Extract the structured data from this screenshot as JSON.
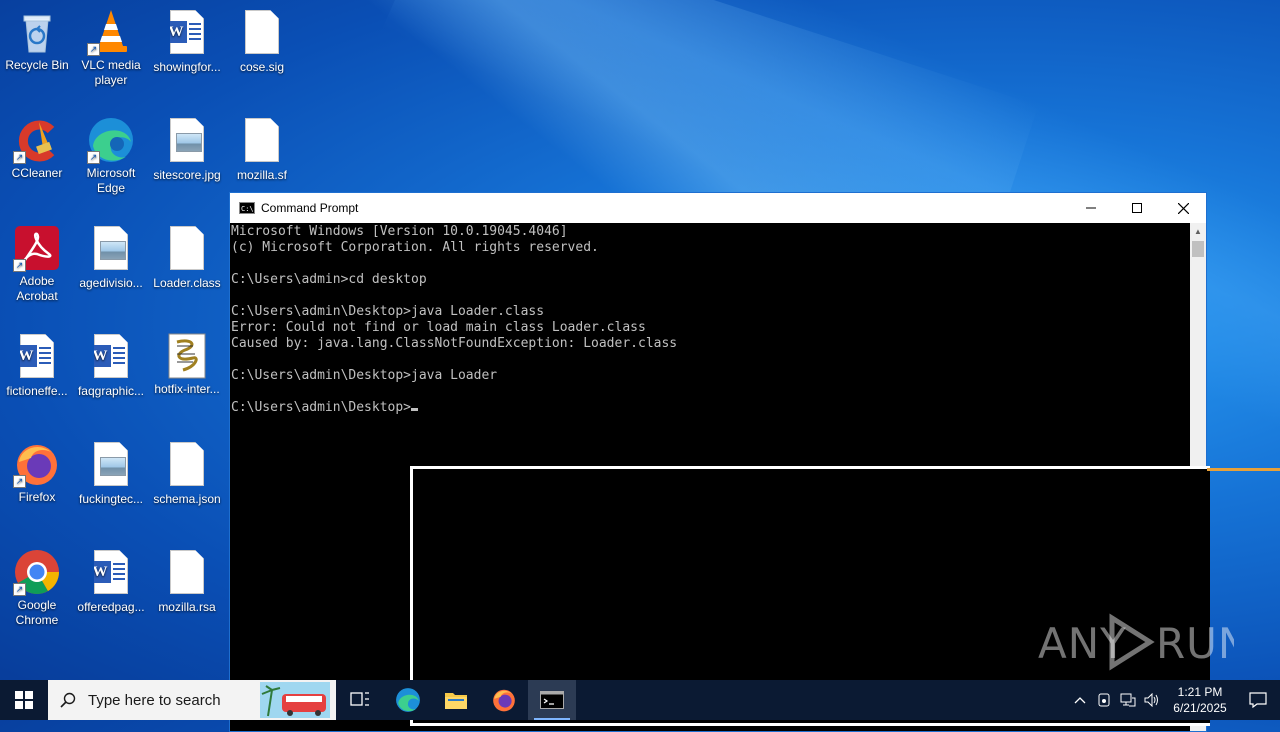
{
  "desktop": {
    "icons": [
      {
        "label": "Recycle Bin",
        "icon": "recycle-bin-icon"
      },
      {
        "label": "VLC media player",
        "icon": "vlc-icon"
      },
      {
        "label": "showingfor...",
        "icon": "word-doc-icon"
      },
      {
        "label": "cose.sig",
        "icon": "file-icon"
      },
      {
        "label": "CCleaner",
        "icon": "ccleaner-icon"
      },
      {
        "label": "Microsoft Edge",
        "icon": "edge-icon"
      },
      {
        "label": "sitescore.jpg",
        "icon": "image-file-icon"
      },
      {
        "label": "mozilla.sf",
        "icon": "file-icon"
      },
      {
        "label": "Adobe Acrobat",
        "icon": "acrobat-icon"
      },
      {
        "label": "agedivisio...",
        "icon": "image-file-icon"
      },
      {
        "label": "Loader.class",
        "icon": "file-icon"
      },
      {
        "label": "fictioneffe...",
        "icon": "word-doc-icon"
      },
      {
        "label": "faqgraphic...",
        "icon": "word-doc-icon"
      },
      {
        "label": "hotfix-inter...",
        "icon": "script-file-icon"
      },
      {
        "label": "Firefox",
        "icon": "firefox-icon"
      },
      {
        "label": "fuckingtec...",
        "icon": "image-file-icon"
      },
      {
        "label": "schema.json",
        "icon": "file-icon"
      },
      {
        "label": "Google Chrome",
        "icon": "chrome-icon"
      },
      {
        "label": "offeredpag...",
        "icon": "word-doc-icon"
      },
      {
        "label": "mozilla.rsa",
        "icon": "file-icon"
      }
    ]
  },
  "cmd": {
    "title": "Command Prompt",
    "lines": [
      "Microsoft Windows [Version 10.0.19045.4046]",
      "(c) Microsoft Corporation. All rights reserved.",
      "",
      "C:\\Users\\admin>cd desktop",
      "",
      "C:\\Users\\admin\\Desktop>java Loader.class",
      "Error: Could not find or load main class Loader.class",
      "Caused by: java.lang.ClassNotFoundException: Loader.class",
      "",
      "C:\\Users\\admin\\Desktop>java Loader",
      ""
    ],
    "prompt": "C:\\Users\\admin\\Desktop>"
  },
  "watermark": {
    "text": "ANY RUN"
  },
  "taskbar": {
    "search_placeholder": "Type here to search",
    "time": "1:21 PM",
    "date": "6/21/2025"
  },
  "colors": {
    "taskbar": "#0b1a33",
    "cmd_text": "#c0c0c0",
    "accent_orange": "#e8a13a"
  }
}
